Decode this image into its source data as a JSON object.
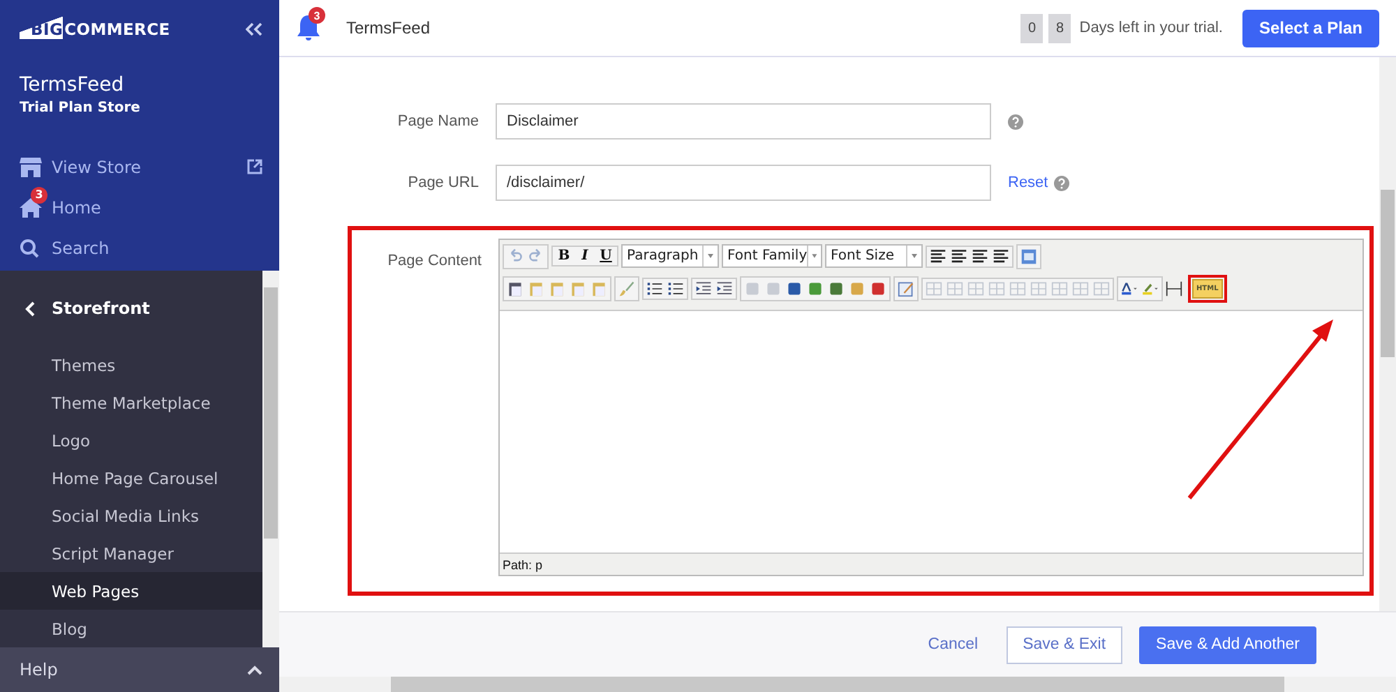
{
  "sidebar": {
    "logo": {
      "mark": "BIG",
      "text": "COMMERCE"
    },
    "store_name": "TermsFeed",
    "store_plan": "Trial Plan Store",
    "top_items": [
      {
        "label": "View Store",
        "kind": "store"
      },
      {
        "label": "Home",
        "kind": "home",
        "badge": "3"
      },
      {
        "label": "Search",
        "kind": "search"
      }
    ],
    "section": "Storefront",
    "items": [
      {
        "label": "Themes",
        "selected": false
      },
      {
        "label": "Theme Marketplace",
        "selected": false
      },
      {
        "label": "Logo",
        "selected": false
      },
      {
        "label": "Home Page Carousel",
        "selected": false
      },
      {
        "label": "Social Media Links",
        "selected": false
      },
      {
        "label": "Script Manager",
        "selected": false
      },
      {
        "label": "Web Pages",
        "selected": true
      },
      {
        "label": "Blog",
        "selected": false
      }
    ],
    "help": "Help"
  },
  "topbar": {
    "notifications": "3",
    "store": "TermsFeed",
    "trial_digits": [
      "0",
      "8"
    ],
    "trial_text": "Days left in your trial.",
    "plan_button": "Select a Plan"
  },
  "form": {
    "page_name": {
      "label": "Page Name",
      "value": "Disclaimer"
    },
    "page_url": {
      "label": "Page URL",
      "value": "/disclaimer/",
      "reset": "Reset"
    },
    "content": {
      "label": "Page Content",
      "bold": "B",
      "italic": "I",
      "underline": "U",
      "format": "Paragraph",
      "font_family": "Font Family",
      "font_size": "Font Size",
      "html": "HTML",
      "path": "Path: p"
    }
  },
  "footer": {
    "cancel": "Cancel",
    "save_exit": "Save & Exit",
    "save_add": "Save & Add Another"
  }
}
